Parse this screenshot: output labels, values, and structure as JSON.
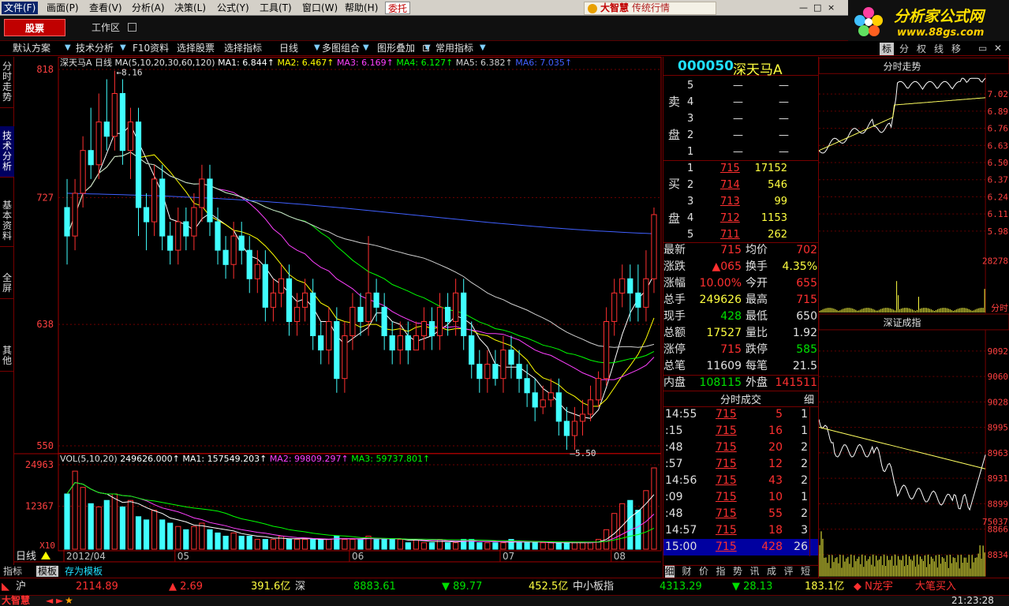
{
  "menu": {
    "items": [
      "文件(F)",
      "画面(P)",
      "查看(V)",
      "分析(A)",
      "决策(L)",
      "公式(Y)",
      "工具(T)",
      "窗口(W)",
      "帮助(H)"
    ],
    "trust": "委托",
    "brand": "大智慧",
    "brand_sub": "传统行情"
  },
  "banner": {
    "title": "分析家公式网",
    "url": "www.88gs.com"
  },
  "row2": {
    "stock_tab": "股票",
    "workspace": "工作区"
  },
  "toolbar": {
    "items": [
      "默认方案",
      "技术分析",
      "F10资料",
      "选择股票",
      "选择指标",
      "日线",
      "多图组合",
      "图形叠加",
      "常用指标"
    ]
  },
  "right_tabs": [
    "标",
    "分",
    "权",
    "线",
    "移"
  ],
  "left_tabs": [
    "分时走势",
    "技术分析",
    "基本资料",
    "全屏",
    "其他"
  ],
  "chart": {
    "stock_label": "深天马A",
    "period": "日线",
    "ma_header": "MA(5,10,20,30,60,120)",
    "ma_vals": [
      {
        "label": "MA1: 6.844",
        "color": "#ffffff"
      },
      {
        "label": "MA2: 6.467",
        "color": "#ffff00"
      },
      {
        "label": "MA3: 6.169",
        "color": "#ff40ff"
      },
      {
        "label": "MA4: 6.127",
        "color": "#00ff00"
      },
      {
        "label": "MA5: 6.382",
        "color": "#d0d0d0"
      },
      {
        "label": "MA6: 7.035",
        "color": "#4060ff"
      }
    ],
    "price_axis": [
      "818",
      "727",
      "638",
      "550"
    ],
    "high_mark": "8.16",
    "low_mark": "5.50",
    "vol_header": "VOL(5,10,20)",
    "vol_vals": [
      {
        "label": "249626.000",
        "color": "#ffffff"
      },
      {
        "label": "MA1: 157549.203",
        "color": "#ffffff"
      },
      {
        "label": "MA2: 99809.297",
        "color": "#ff40ff"
      },
      {
        "label": "MA3: 59737.801",
        "color": "#00ff00"
      }
    ],
    "vol_axis": [
      "24963",
      "12367"
    ],
    "vol_unit": "X10",
    "date_labels": [
      "2012/04",
      "05",
      "06",
      "07",
      "08"
    ],
    "period_footer": "日线",
    "bottom_tabs": [
      "指标",
      "模板",
      "存为模板"
    ]
  },
  "chart_data": {
    "type": "candlestick",
    "title": "深天马A",
    "ylim": [
      5.5,
      8.18
    ],
    "candles": [
      [
        7.2,
        7.0,
        7.4,
        6.8
      ],
      [
        7.0,
        7.3,
        7.4,
        6.9
      ],
      [
        7.3,
        7.6,
        7.7,
        7.2
      ],
      [
        7.6,
        7.5,
        7.9,
        7.4
      ],
      [
        7.5,
        7.8,
        8.0,
        7.4
      ],
      [
        7.8,
        7.7,
        8.1,
        7.6
      ],
      [
        7.7,
        8.0,
        8.16,
        7.6
      ],
      [
        8.0,
        7.6,
        8.1,
        7.5
      ],
      [
        7.6,
        7.8,
        7.9,
        7.4
      ],
      [
        7.8,
        7.2,
        7.9,
        7.0
      ],
      [
        7.2,
        7.1,
        7.3,
        6.9
      ],
      [
        7.1,
        7.4,
        7.5,
        7.0
      ],
      [
        7.4,
        7.0,
        7.5,
        6.9
      ],
      [
        7.0,
        6.9,
        7.1,
        6.8
      ],
      [
        6.9,
        7.1,
        7.2,
        6.8
      ],
      [
        7.1,
        7.0,
        7.2,
        6.9
      ],
      [
        7.0,
        7.2,
        7.3,
        6.9
      ],
      [
        7.2,
        7.4,
        7.5,
        7.1
      ],
      [
        7.4,
        7.1,
        7.5,
        7.0
      ],
      [
        7.1,
        6.9,
        7.2,
        6.8
      ],
      [
        6.9,
        6.8,
        7.0,
        6.7
      ],
      [
        6.8,
        7.0,
        7.1,
        6.7
      ],
      [
        7.0,
        6.9,
        7.1,
        6.8
      ],
      [
        6.9,
        6.7,
        7.0,
        6.6
      ],
      [
        6.7,
        6.8,
        6.9,
        6.6
      ],
      [
        6.8,
        6.5,
        6.9,
        6.4
      ],
      [
        6.5,
        6.6,
        6.7,
        6.4
      ],
      [
        6.6,
        6.7,
        6.8,
        6.5
      ],
      [
        6.7,
        6.4,
        6.8,
        6.3
      ],
      [
        6.4,
        6.5,
        6.6,
        6.3
      ],
      [
        6.5,
        6.6,
        6.7,
        6.4
      ],
      [
        6.6,
        6.3,
        6.7,
        6.2
      ],
      [
        6.3,
        6.2,
        6.4,
        6.1
      ],
      [
        6.2,
        6.4,
        6.5,
        6.1
      ],
      [
        6.4,
        6.0,
        6.5,
        5.9
      ],
      [
        6.0,
        6.3,
        6.4,
        5.9
      ],
      [
        6.3,
        6.5,
        6.6,
        6.2
      ],
      [
        6.5,
        6.4,
        6.6,
        6.3
      ],
      [
        6.4,
        6.6,
        7.0,
        6.3
      ],
      [
        6.6,
        6.5,
        6.7,
        6.4
      ],
      [
        6.5,
        6.3,
        6.6,
        6.2
      ],
      [
        6.3,
        6.2,
        6.4,
        6.1
      ],
      [
        6.2,
        6.3,
        6.4,
        6.1
      ],
      [
        6.3,
        6.2,
        6.4,
        6.1
      ],
      [
        6.2,
        6.3,
        6.4,
        6.2
      ],
      [
        6.3,
        6.4,
        6.5,
        6.2
      ],
      [
        6.4,
        6.3,
        6.5,
        6.2
      ],
      [
        6.3,
        6.5,
        6.6,
        6.2
      ],
      [
        6.5,
        6.4,
        6.6,
        6.3
      ],
      [
        6.4,
        6.6,
        6.7,
        6.3
      ],
      [
        6.6,
        6.3,
        6.7,
        6.2
      ],
      [
        6.3,
        6.1,
        6.4,
        6.0
      ],
      [
        6.1,
        6.0,
        6.2,
        5.9
      ],
      [
        6.0,
        6.1,
        6.2,
        5.9
      ],
      [
        6.1,
        6.0,
        6.2,
        5.95
      ],
      [
        6.0,
        6.2,
        6.3,
        5.9
      ],
      [
        6.2,
        6.1,
        6.3,
        6.0
      ],
      [
        6.1,
        6.0,
        6.2,
        5.9
      ],
      [
        6.0,
        5.9,
        6.1,
        5.8
      ],
      [
        5.9,
        5.8,
        6.0,
        5.7
      ],
      [
        5.8,
        5.85,
        5.95,
        5.75
      ],
      [
        5.85,
        5.9,
        6.0,
        5.8
      ],
      [
        5.9,
        5.7,
        6.0,
        5.6
      ],
      [
        5.7,
        5.6,
        5.8,
        5.5
      ],
      [
        5.6,
        5.7,
        5.8,
        5.5
      ],
      [
        5.7,
        5.75,
        5.85,
        5.6
      ],
      [
        5.75,
        5.85,
        5.95,
        5.7
      ],
      [
        5.85,
        6.0,
        6.05,
        5.8
      ],
      [
        6.0,
        6.4,
        6.5,
        5.95
      ],
      [
        6.4,
        6.6,
        6.7,
        6.3
      ],
      [
        6.6,
        6.7,
        6.8,
        6.5
      ],
      [
        6.7,
        6.6,
        6.8,
        6.4
      ],
      [
        6.6,
        6.5,
        6.8,
        6.4
      ],
      [
        6.5,
        6.7,
        6.9,
        6.4
      ],
      [
        6.7,
        7.15,
        7.2,
        6.6
      ]
    ],
    "volumes": [
      17,
      24,
      19,
      14,
      13,
      15,
      17,
      13,
      15,
      10,
      9,
      12,
      9,
      8,
      7,
      6,
      7,
      8,
      6,
      5,
      4,
      5,
      4,
      4,
      3,
      3,
      3,
      4,
      3,
      3,
      3,
      3,
      3,
      3,
      4,
      3,
      3,
      3,
      4,
      3,
      3,
      3,
      3,
      2,
      3,
      2,
      2,
      3,
      2,
      2,
      3,
      3,
      2,
      2,
      2,
      2,
      3,
      2,
      2,
      2,
      2,
      2,
      2,
      2,
      2,
      2,
      2,
      3,
      6,
      11,
      14,
      15,
      12,
      18,
      25
    ],
    "colors": {
      "up": "#ff3030",
      "down": "#40ffff",
      "ma5": "#ffffff",
      "ma10": "#ffff00",
      "ma20": "#ff40ff",
      "ma30": "#00ff00",
      "ma60": "#d0d0d0",
      "ma120": "#4060ff"
    }
  },
  "quote": {
    "code": "000050",
    "name": "深天马A",
    "sell_label": [
      "卖",
      "盘"
    ],
    "buy_label": [
      "买",
      "盘"
    ],
    "sell": [
      {
        "n": "5",
        "p": "—",
        "v": "—"
      },
      {
        "n": "4",
        "p": "—",
        "v": "—"
      },
      {
        "n": "3",
        "p": "—",
        "v": "—"
      },
      {
        "n": "2",
        "p": "—",
        "v": "—"
      },
      {
        "n": "1",
        "p": "—",
        "v": "—"
      }
    ],
    "buy": [
      {
        "n": "1",
        "p": "715",
        "v": "17152"
      },
      {
        "n": "2",
        "p": "714",
        "v": "546"
      },
      {
        "n": "3",
        "p": "713",
        "v": "99"
      },
      {
        "n": "4",
        "p": "712",
        "v": "1153"
      },
      {
        "n": "5",
        "p": "711",
        "v": "262"
      }
    ],
    "stats": [
      {
        "k1": "最新",
        "v1": "715",
        "c1": "red",
        "k2": "均价",
        "v2": "702",
        "c2": "red"
      },
      {
        "k1": "涨跌",
        "v1": "▲065",
        "c1": "red",
        "k2": "换手",
        "v2": "4.35%",
        "c2": "yel"
      },
      {
        "k1": "涨幅",
        "v1": "10.00%",
        "c1": "red",
        "k2": "今开",
        "v2": "655",
        "c2": "red"
      },
      {
        "k1": "总手",
        "v1": "249626",
        "c1": "yel",
        "k2": "最高",
        "v2": "715",
        "c2": "red"
      },
      {
        "k1": "现手",
        "v1": "428",
        "c1": "green",
        "k2": "最低",
        "v2": "650",
        "c2": "white"
      },
      {
        "k1": "总额",
        "v1": "17527",
        "c1": "yel",
        "k2": "量比",
        "v2": "1.92",
        "c2": "white"
      },
      {
        "k1": "涨停",
        "v1": "715",
        "c1": "red",
        "k2": "跌停",
        "v2": "585",
        "c2": "green"
      },
      {
        "k1": "总笔",
        "v1": "11609",
        "c1": "white",
        "k2": "每笔",
        "v2": "21.5",
        "c2": "white"
      },
      {
        "k1": "内盘",
        "v1": "108115",
        "c1": "green",
        "k2": "外盘",
        "v2": "141511",
        "c2": "red"
      }
    ],
    "trade_title": "分时成交",
    "trade_detail": "细",
    "trades": [
      {
        "t": "14:55",
        "p": "715",
        "v": "5",
        "n": "1"
      },
      {
        "t": ":15",
        "p": "715",
        "v": "16",
        "n": "1"
      },
      {
        "t": ":48",
        "p": "715",
        "v": "20",
        "n": "2"
      },
      {
        "t": ":57",
        "p": "715",
        "v": "12",
        "n": "2"
      },
      {
        "t": "14:56",
        "p": "715",
        "v": "43",
        "n": "2"
      },
      {
        "t": ":09",
        "p": "715",
        "v": "10",
        "n": "1"
      },
      {
        "t": ":48",
        "p": "715",
        "v": "55",
        "n": "2"
      },
      {
        "t": "14:57",
        "p": "715",
        "v": "18",
        "n": "3"
      },
      {
        "t": "15:00",
        "p": "715",
        "v": "428",
        "n": "26"
      }
    ],
    "bottom_tabs": [
      "细",
      "财",
      "价",
      "指",
      "势",
      "讯",
      "成",
      "评",
      "短"
    ]
  },
  "right_panel": {
    "intraday_title": "分时走势",
    "intraday_axis": [
      "7.02",
      "6.89",
      "6.76",
      "6.63",
      "6.50",
      "6.37",
      "6.24",
      "6.11",
      "5.98"
    ],
    "intraday_vol_top": "28278",
    "time_label": "分时",
    "index_title": "深证成指",
    "index_axis": [
      "9092",
      "9060",
      "9028",
      "8995",
      "8963",
      "8931",
      "8899",
      "8866",
      "8834"
    ],
    "index_vol_top": "75037"
  },
  "status": {
    "sh": "沪",
    "sh_val": "2114.89",
    "sh_chg": "▲ 2.69",
    "sh_amt": "391.6亿",
    "sz": "深",
    "sz_val": "8883.61",
    "sz_chg": "▼ 89.77",
    "sz_amt": "452.5亿",
    "sme": "中小板指",
    "sme_val": "4313.29",
    "sme_chg": "▼ 28.13",
    "sme_amt": "183.1亿",
    "alert": "◆ N龙宇",
    "alert2": "大笔买入",
    "clock": "21:23:28",
    "brand": "大智慧"
  }
}
